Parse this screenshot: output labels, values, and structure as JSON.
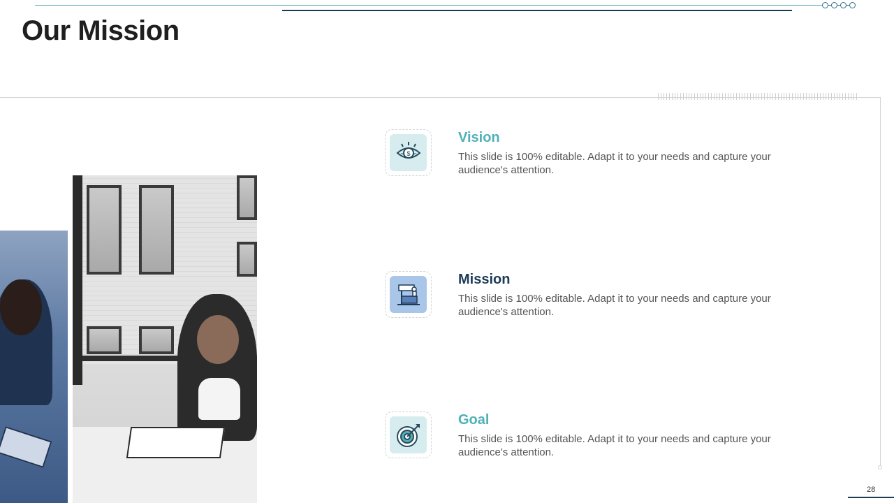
{
  "slide": {
    "title": "Our Mission",
    "page_number": "28"
  },
  "items": [
    {
      "title": "Vision",
      "text": "This slide is 100% editable. Adapt it to your needs and capture your audience's attention.",
      "icon": "eye-icon"
    },
    {
      "title": "Mission",
      "text": "This slide is 100% editable. Adapt it to your needs and capture your audience's attention.",
      "icon": "desk-icon"
    },
    {
      "title": "Goal",
      "text": "This slide is 100% editable. Adapt it to your needs and capture your audience's attention.",
      "icon": "target-icon"
    }
  ],
  "colors": {
    "accent_teal": "#4fb1b7",
    "accent_navy": "#1d3a57",
    "body_text": "#555555"
  }
}
